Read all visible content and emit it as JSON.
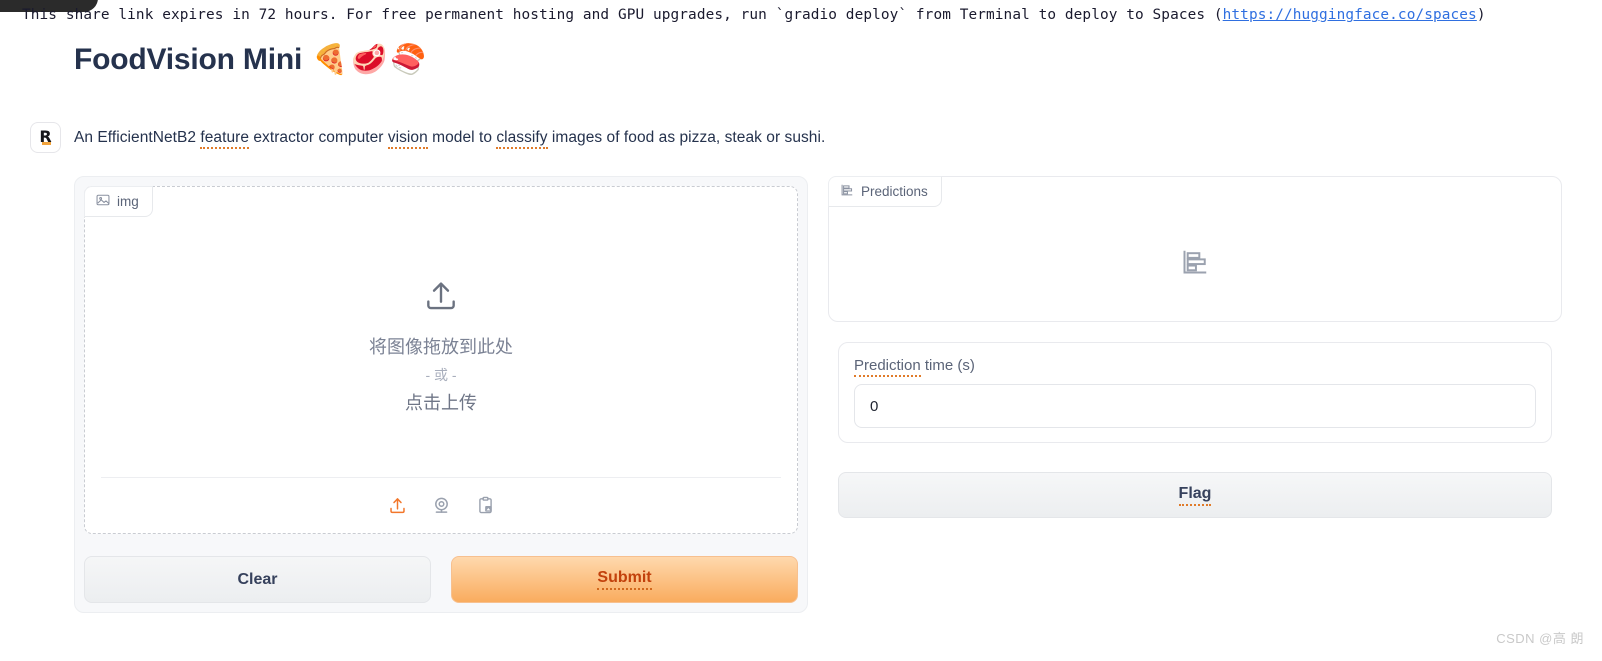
{
  "banner": {
    "text_before": "This share link expires in 72 hours. For free permanent hosting and GPU upgrades, run `gradio deploy` from Terminal to deploy to Spaces (",
    "link": "https://huggingface.co/spaces",
    "text_after": ")",
    "link_color": "#2f6fe0"
  },
  "header": {
    "title": "FoodVision Mini",
    "emojis": "🍕🥩🍣"
  },
  "description": {
    "badge_letter": "R",
    "part1": "An EfficientNetB2 ",
    "word1": "feature",
    "part2": " extractor computer ",
    "word2": "vision",
    "part3": " model to ",
    "word3": "classify",
    "part4": " images of food as pizza, steak or sushi."
  },
  "image_panel": {
    "tab_label": "img",
    "tab_icon": "image-icon",
    "drop_icon": "upload-icon",
    "drop_line1": "将图像拖放到此处",
    "drop_or": "- 或 -",
    "drop_line2": "点击上传",
    "tools": [
      {
        "icon": "upload-icon",
        "active": true
      },
      {
        "icon": "webcam-icon",
        "active": false
      },
      {
        "icon": "clipboard-image-icon",
        "active": false
      }
    ],
    "clear_label": "Clear",
    "submit_label": "Submit"
  },
  "predictions_panel": {
    "tab_label": "Predictions",
    "tab_icon": "bar-chart-icon",
    "placeholder_icon": "bar-chart-icon"
  },
  "prediction_time": {
    "label_underlined": "Prediction",
    "label_rest": " time (s)",
    "value": "0"
  },
  "flag": {
    "label": "Flag"
  },
  "watermark": {
    "text": "CSDN @高 朗"
  },
  "colors": {
    "accent_orange": "#e07b2a",
    "submit_text": "#c2410c",
    "link_blue": "#2f6fe0",
    "text_dark": "#25324d",
    "panel_bg": "#f7f8fa"
  }
}
